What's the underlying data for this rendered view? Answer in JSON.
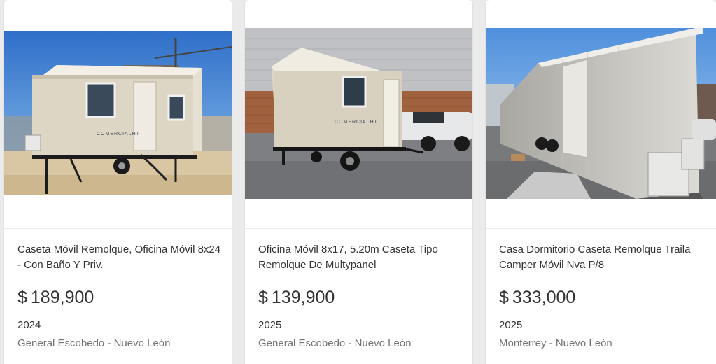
{
  "listings": [
    {
      "title": "Caseta Móvil Remolque, Oficina Móvil 8x24 - Con Baño Y Priv.",
      "currency": "$",
      "price": "189,900",
      "year": "2024",
      "location": "General Escobedo - Nuevo León",
      "brand_on_image": "COMERCIALHT"
    },
    {
      "title": "Oficina Móvil 8x17, 5.20m Caseta Tipo Remolque De Multypanel",
      "currency": "$",
      "price": "139,900",
      "year": "2025",
      "location": "General Escobedo - Nuevo León",
      "brand_on_image": "COMERCIALHT"
    },
    {
      "title": "Casa Dormitorio Caseta Remolque Traila Camper Móvil Nva P/8",
      "currency": "$",
      "price": "333,000",
      "year": "2025",
      "location": "Monterrey - Nuevo León"
    }
  ],
  "colors": {
    "page_background": "#ebebeb",
    "card_background": "#ffffff",
    "text_primary": "#333333",
    "text_secondary": "#737373"
  }
}
